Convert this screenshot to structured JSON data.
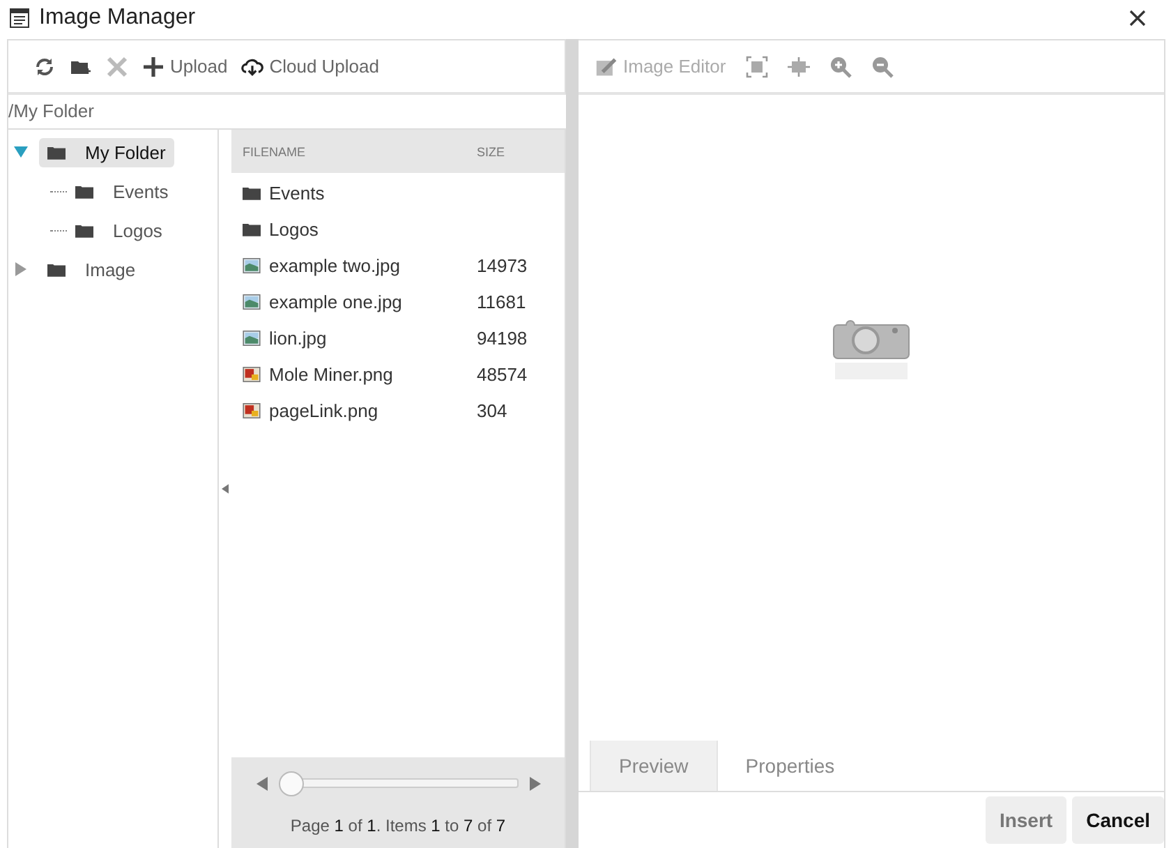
{
  "window": {
    "title": "Image Manager"
  },
  "toolbar": [
    {
      "kind": "refresh"
    },
    {
      "kind": "new-folder"
    },
    {
      "kind": "delete"
    },
    {
      "kind": "upload",
      "label": "Upload"
    },
    {
      "kind": "cloud",
      "label": "Cloud Upload"
    }
  ],
  "path": "/My Folder",
  "tree": [
    {
      "label": "My Folder",
      "selected": true,
      "expanded": true,
      "children": [
        {
          "label": "Events",
          "selected": false
        },
        {
          "label": "Logos",
          "selected": false
        }
      ]
    },
    {
      "label": "Image",
      "selected": false,
      "expanded": false
    }
  ],
  "table": {
    "columns": [
      "FILENAME",
      "SIZE"
    ],
    "rows": [
      {
        "kind": "folder",
        "name": "Events"
      },
      {
        "kind": "folder",
        "name": "Logos"
      },
      {
        "kind": "photo",
        "name": "example two.jpg",
        "size": "14973"
      },
      {
        "kind": "photo",
        "name": "example one.jpg",
        "size": "11681"
      },
      {
        "kind": "photo",
        "name": "lion.jpg",
        "size": "94198"
      },
      {
        "kind": "png",
        "name": "Mole Miner.png",
        "size": "48574"
      },
      {
        "kind": "png",
        "name": "pageLink.png",
        "size": "304"
      }
    ]
  },
  "pager": {
    "level": 0,
    "text": "Page **1** of **1**. Items **1** to **7** of **7**"
  },
  "editor_toolbar": [
    {
      "kind": "editor",
      "label": "Image Editor"
    },
    {
      "kind": "fit"
    },
    {
      "kind": "actual"
    },
    {
      "kind": "zoom-in"
    },
    {
      "kind": "zoom-out"
    }
  ],
  "tabs": [
    {
      "label": "Preview",
      "selected": true
    },
    {
      "label": "Properties",
      "selected": false
    }
  ],
  "buttons": [
    {
      "label": "Insert",
      "disabled": true
    },
    {
      "label": "Cancel",
      "disabled": false
    }
  ]
}
